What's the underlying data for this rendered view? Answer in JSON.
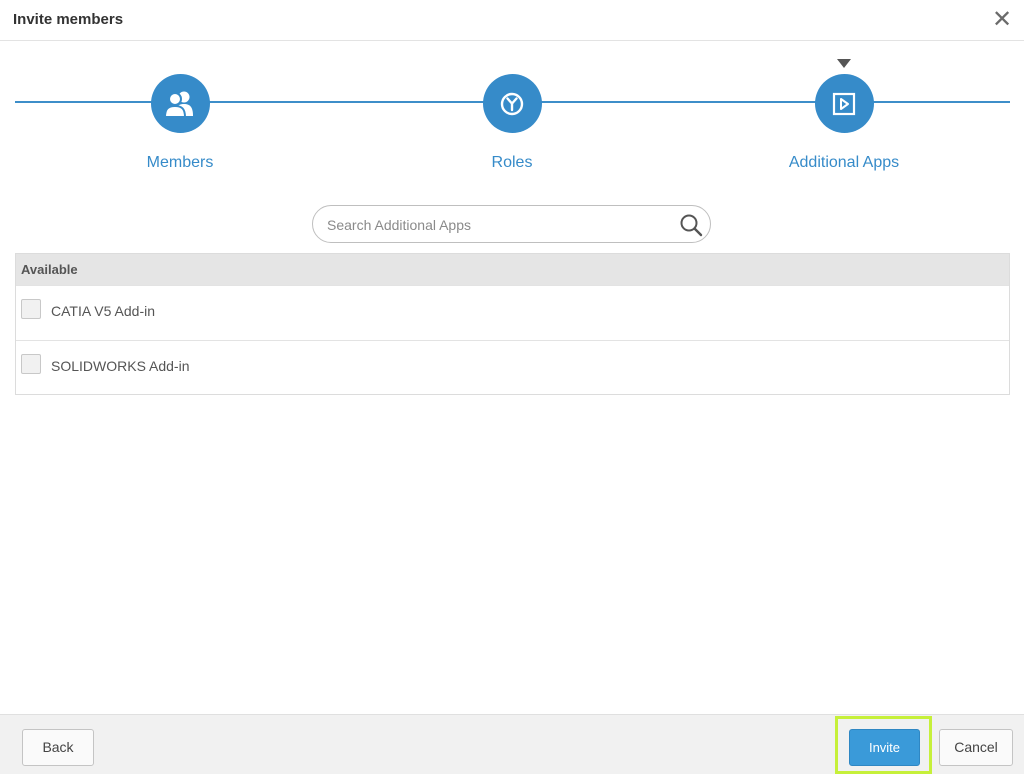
{
  "dialog": {
    "title": "Invite members",
    "close_symbol": "✕"
  },
  "wizard": {
    "steps": [
      {
        "label": "Members",
        "icon": "members-icon"
      },
      {
        "label": "Roles",
        "icon": "roles-icon"
      },
      {
        "label": "Additional Apps",
        "icon": "additional-apps-icon"
      }
    ],
    "current_step": 2,
    "accent_color": "#368bc9"
  },
  "search": {
    "placeholder": "Search Additional Apps",
    "value": ""
  },
  "table": {
    "header": "Available",
    "rows": [
      {
        "name": "CATIA V5 Add-in",
        "checked": false
      },
      {
        "name": "SOLIDWORKS Add-in",
        "checked": false
      }
    ]
  },
  "footer": {
    "back_label": "Back",
    "invite_label": "Invite",
    "cancel_label": "Cancel",
    "highlight_color": "#c6f03a"
  }
}
